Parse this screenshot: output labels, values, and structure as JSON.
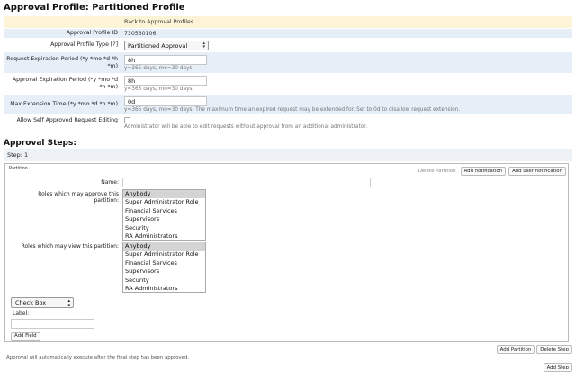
{
  "page_title": "Approval Profile: Partitioned Profile",
  "profile": {
    "back_link": "Back to Approval Profiles",
    "id_label": "Approval Profile ID",
    "id_value": "730530106",
    "type_label": "Approval Profile Type [?]",
    "type_value": "Partitioned Approval",
    "req_exp_label": "Request Expiration Period (*y *mo *d *h *m)",
    "req_exp_value": "8h",
    "req_exp_hint": "y=365 days, mo=30 days",
    "appr_exp_label": "Approval Expiration Period (*y *mo *d *h *m)",
    "appr_exp_value": "8h",
    "appr_exp_hint": "y=365 days, mo=30 days",
    "max_ext_label": "Max Extension Time (*y *mo *d *h *m)",
    "max_ext_value": "0d",
    "max_ext_hint": "y=365 days, mo=30 days. The maximum time an expired request may be extended for. Set to 0d to disallow request extension.",
    "self_edit_label": "Allow Self Approved Request Editing",
    "self_edit_hint": "Administrator will be able to edit requests without approval from an additional administrator."
  },
  "steps_title": "Approval Steps:",
  "step_label": "Step: 1",
  "partition": {
    "title": "Partition",
    "delete_partition": "Delete Partition",
    "add_notification": "Add notification",
    "add_user_notification": "Add user notification",
    "name_label": "Name:",
    "name_value": "",
    "approve_label": "Roles which may approve this partition:",
    "view_label": "Roles which may view this partition:",
    "roles": [
      "Anybody",
      "Super Administrator Role",
      "Financial Services",
      "Supervisors",
      "Security",
      "RA Administrators"
    ],
    "approve_selected": "Anybody",
    "view_selected": "Anybody",
    "field_type": "Check Box",
    "label_label": "Label:",
    "label_value": "",
    "add_field": "Add Field"
  },
  "add_partition": "Add Partition",
  "delete_step": "Delete Step",
  "footer_note": "Approval will automatically execute after the final step has been approved.",
  "add_step": "Add Step",
  "colors": {
    "row_blue": "#e6eef8",
    "banner": "#fdf3d7",
    "selected_option": "#d4d4d4"
  }
}
